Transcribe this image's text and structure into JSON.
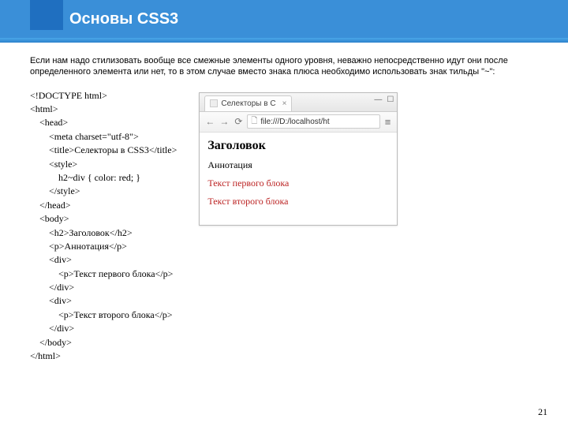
{
  "header": {
    "title": "Основы CSS3"
  },
  "intro": "Если нам надо стилизовать вообще все смежные элементы одного уровня, неважно непосредственно идут они после определенного элемента или нет, то в этом случае вместо знака плюса необходимо использовать знак тильды \"~\":",
  "code": "<!DOCTYPE html>\n<html>\n    <head>\n        <meta charset=\"utf-8\">\n        <title>Селекторы в CSS3</title>\n        <style>\n            h2~div { color: red; }\n        </style>\n    </head>\n    <body>\n        <h2>Заголовок</h2>\n        <p>Аннотация</p>\n        <div>\n            <p>Текст первого блока</p>\n        </div>\n        <div>\n            <p>Текст второго блока</p>\n        </div>\n    </body>\n</html>",
  "browser": {
    "tab_title": "Селекторы в С",
    "tab_close": "×",
    "win_min": "—",
    "win_max": "☐",
    "nav_back": "←",
    "nav_fwd": "→",
    "nav_reload": "⟳",
    "url": "file:///D:/localhost/ht",
    "menu": "≡",
    "page_icon": "🗋",
    "heading": "Заголовок",
    "annotation": "Аннотация",
    "block1": "Текст первого блока",
    "block2": "Текст второго блока"
  },
  "page_number": "21"
}
